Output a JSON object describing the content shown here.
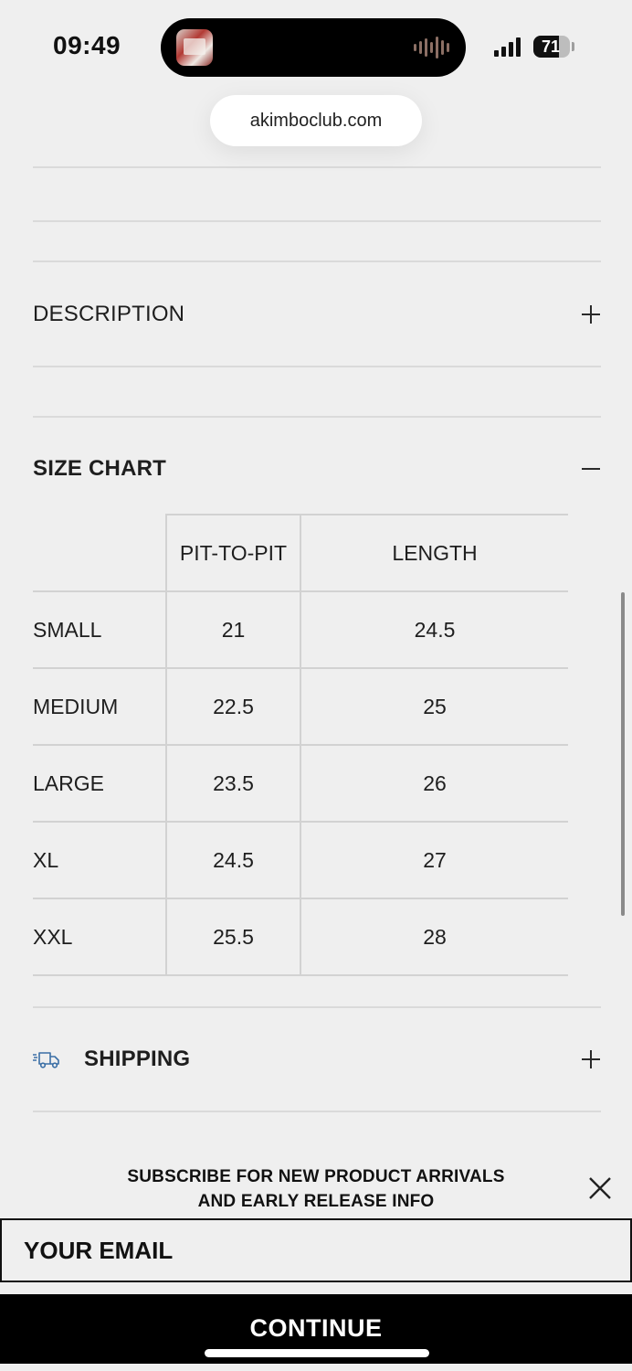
{
  "status_bar": {
    "time": "09:49",
    "battery_level": "71",
    "battery_fraction": 0.71
  },
  "browser": {
    "url": "akimboclub.com"
  },
  "accordions": {
    "description": {
      "title": "DESCRIPTION",
      "state": "collapsed"
    },
    "size_chart": {
      "title": "SIZE CHART",
      "state": "expanded"
    },
    "shipping": {
      "title": "SHIPPING",
      "state": "collapsed",
      "icon": "truck-icon",
      "icon_color": "#3b6fa6"
    }
  },
  "size_chart": {
    "columns": [
      "",
      "PIT-TO-PIT",
      "LENGTH"
    ],
    "rows": [
      {
        "size": "SMALL",
        "pit_to_pit": "21",
        "length": "24.5"
      },
      {
        "size": "MEDIUM",
        "pit_to_pit": "22.5",
        "length": "25"
      },
      {
        "size": "LARGE",
        "pit_to_pit": "23.5",
        "length": "26"
      },
      {
        "size": "XL",
        "pit_to_pit": "24.5",
        "length": "27"
      },
      {
        "size": "XXL",
        "pit_to_pit": "25.5",
        "length": "28"
      }
    ]
  },
  "subscribe": {
    "message": "SUBSCRIBE FOR NEW PRODUCT ARRIVALS\nAND EARLY RELEASE INFO",
    "email_placeholder": "YOUR EMAIL",
    "button_label": "CONTINUE"
  },
  "colors": {
    "background": "#efefef",
    "button_background": "#000000",
    "button_text": "#ffffff",
    "separator": "#dadada"
  }
}
